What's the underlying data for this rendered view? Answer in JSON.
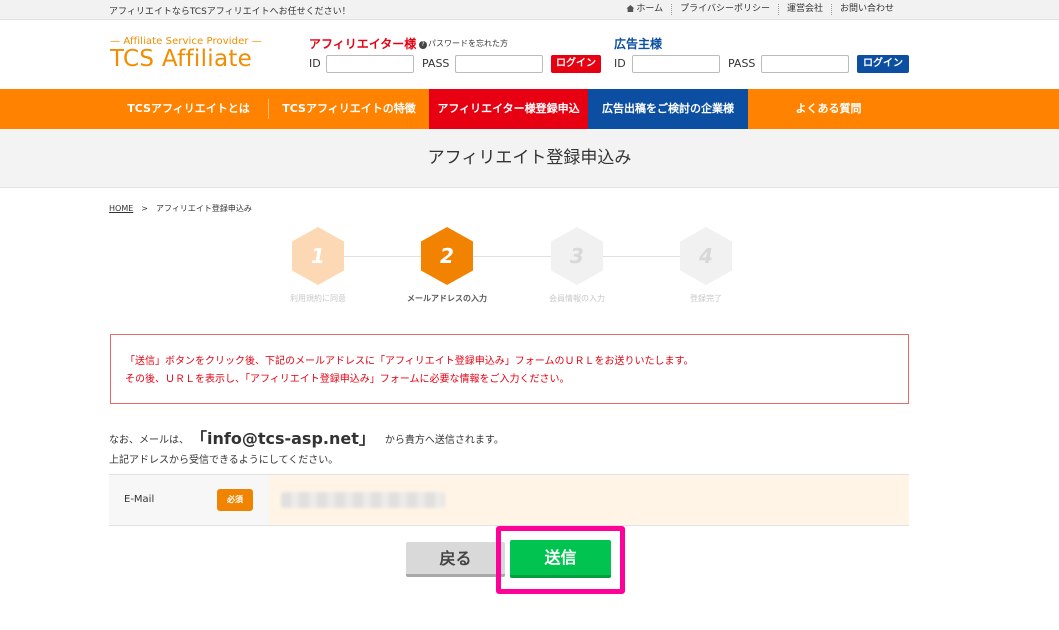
{
  "topbar": {
    "tagline": "アフィリエイトならTCSアフィリエイトへお任せください！",
    "links": [
      "ホーム",
      "プライバシーポリシー",
      "運営会社",
      "お問い合わせ"
    ]
  },
  "logo": {
    "sub": "— Affiliate Service Provider —",
    "main": "TCS Affiliate"
  },
  "affiliate_login": {
    "title": "アフィリエイター様",
    "forgot": "パスワードを忘れた方",
    "id_label": "ID",
    "pass_label": "PASS",
    "button": "ログイン"
  },
  "advertiser_login": {
    "title": "広告主様",
    "id_label": "ID",
    "pass_label": "PASS",
    "button": "ログイン"
  },
  "nav": [
    "TCSアフィリエイトとは",
    "TCSアフィリエイトの特徴",
    "アフィリエイター様登録申込",
    "広告出稿をご検討の企業様",
    "よくある質問"
  ],
  "page_title": "アフィリエイト登録申込み",
  "breadcrumb": {
    "home": "HOME",
    "sep": ">",
    "current": "アフィリエイト登録申込み"
  },
  "steps": [
    {
      "num": "1",
      "label": "利用規約に同意"
    },
    {
      "num": "2",
      "label": "メールアドレスの入力"
    },
    {
      "num": "3",
      "label": "会員情報の入力"
    },
    {
      "num": "4",
      "label": "登録完了"
    }
  ],
  "current_step": 2,
  "notice": {
    "line1": "「送信」ボタンをクリック後、下記のメールアドレスに「アフィリエイト登録申込み」フォームのＵＲＬをお送りいたします。",
    "line2": "その後、ＵＲＬを表示し、「アフィリエイト登録申込み」フォームに必要な情報をご入力ください。"
  },
  "mail_info": {
    "prefix": "なお、メールは、",
    "address": "「info@tcs-asp.net」",
    "suffix": "から貴方へ送信されます。",
    "line2": "上記アドレスから受信できるようにしてください。"
  },
  "form": {
    "email_label": "E-Mail",
    "required_badge": "必須"
  },
  "buttons": {
    "back": "戻る",
    "send": "送信"
  },
  "colors": {
    "orange": "#ff8200",
    "affiliate_red": "#e60012",
    "advertiser_blue": "#0b4ea2",
    "send_green": "#00c44f",
    "highlight_pink": "#ff0099"
  }
}
